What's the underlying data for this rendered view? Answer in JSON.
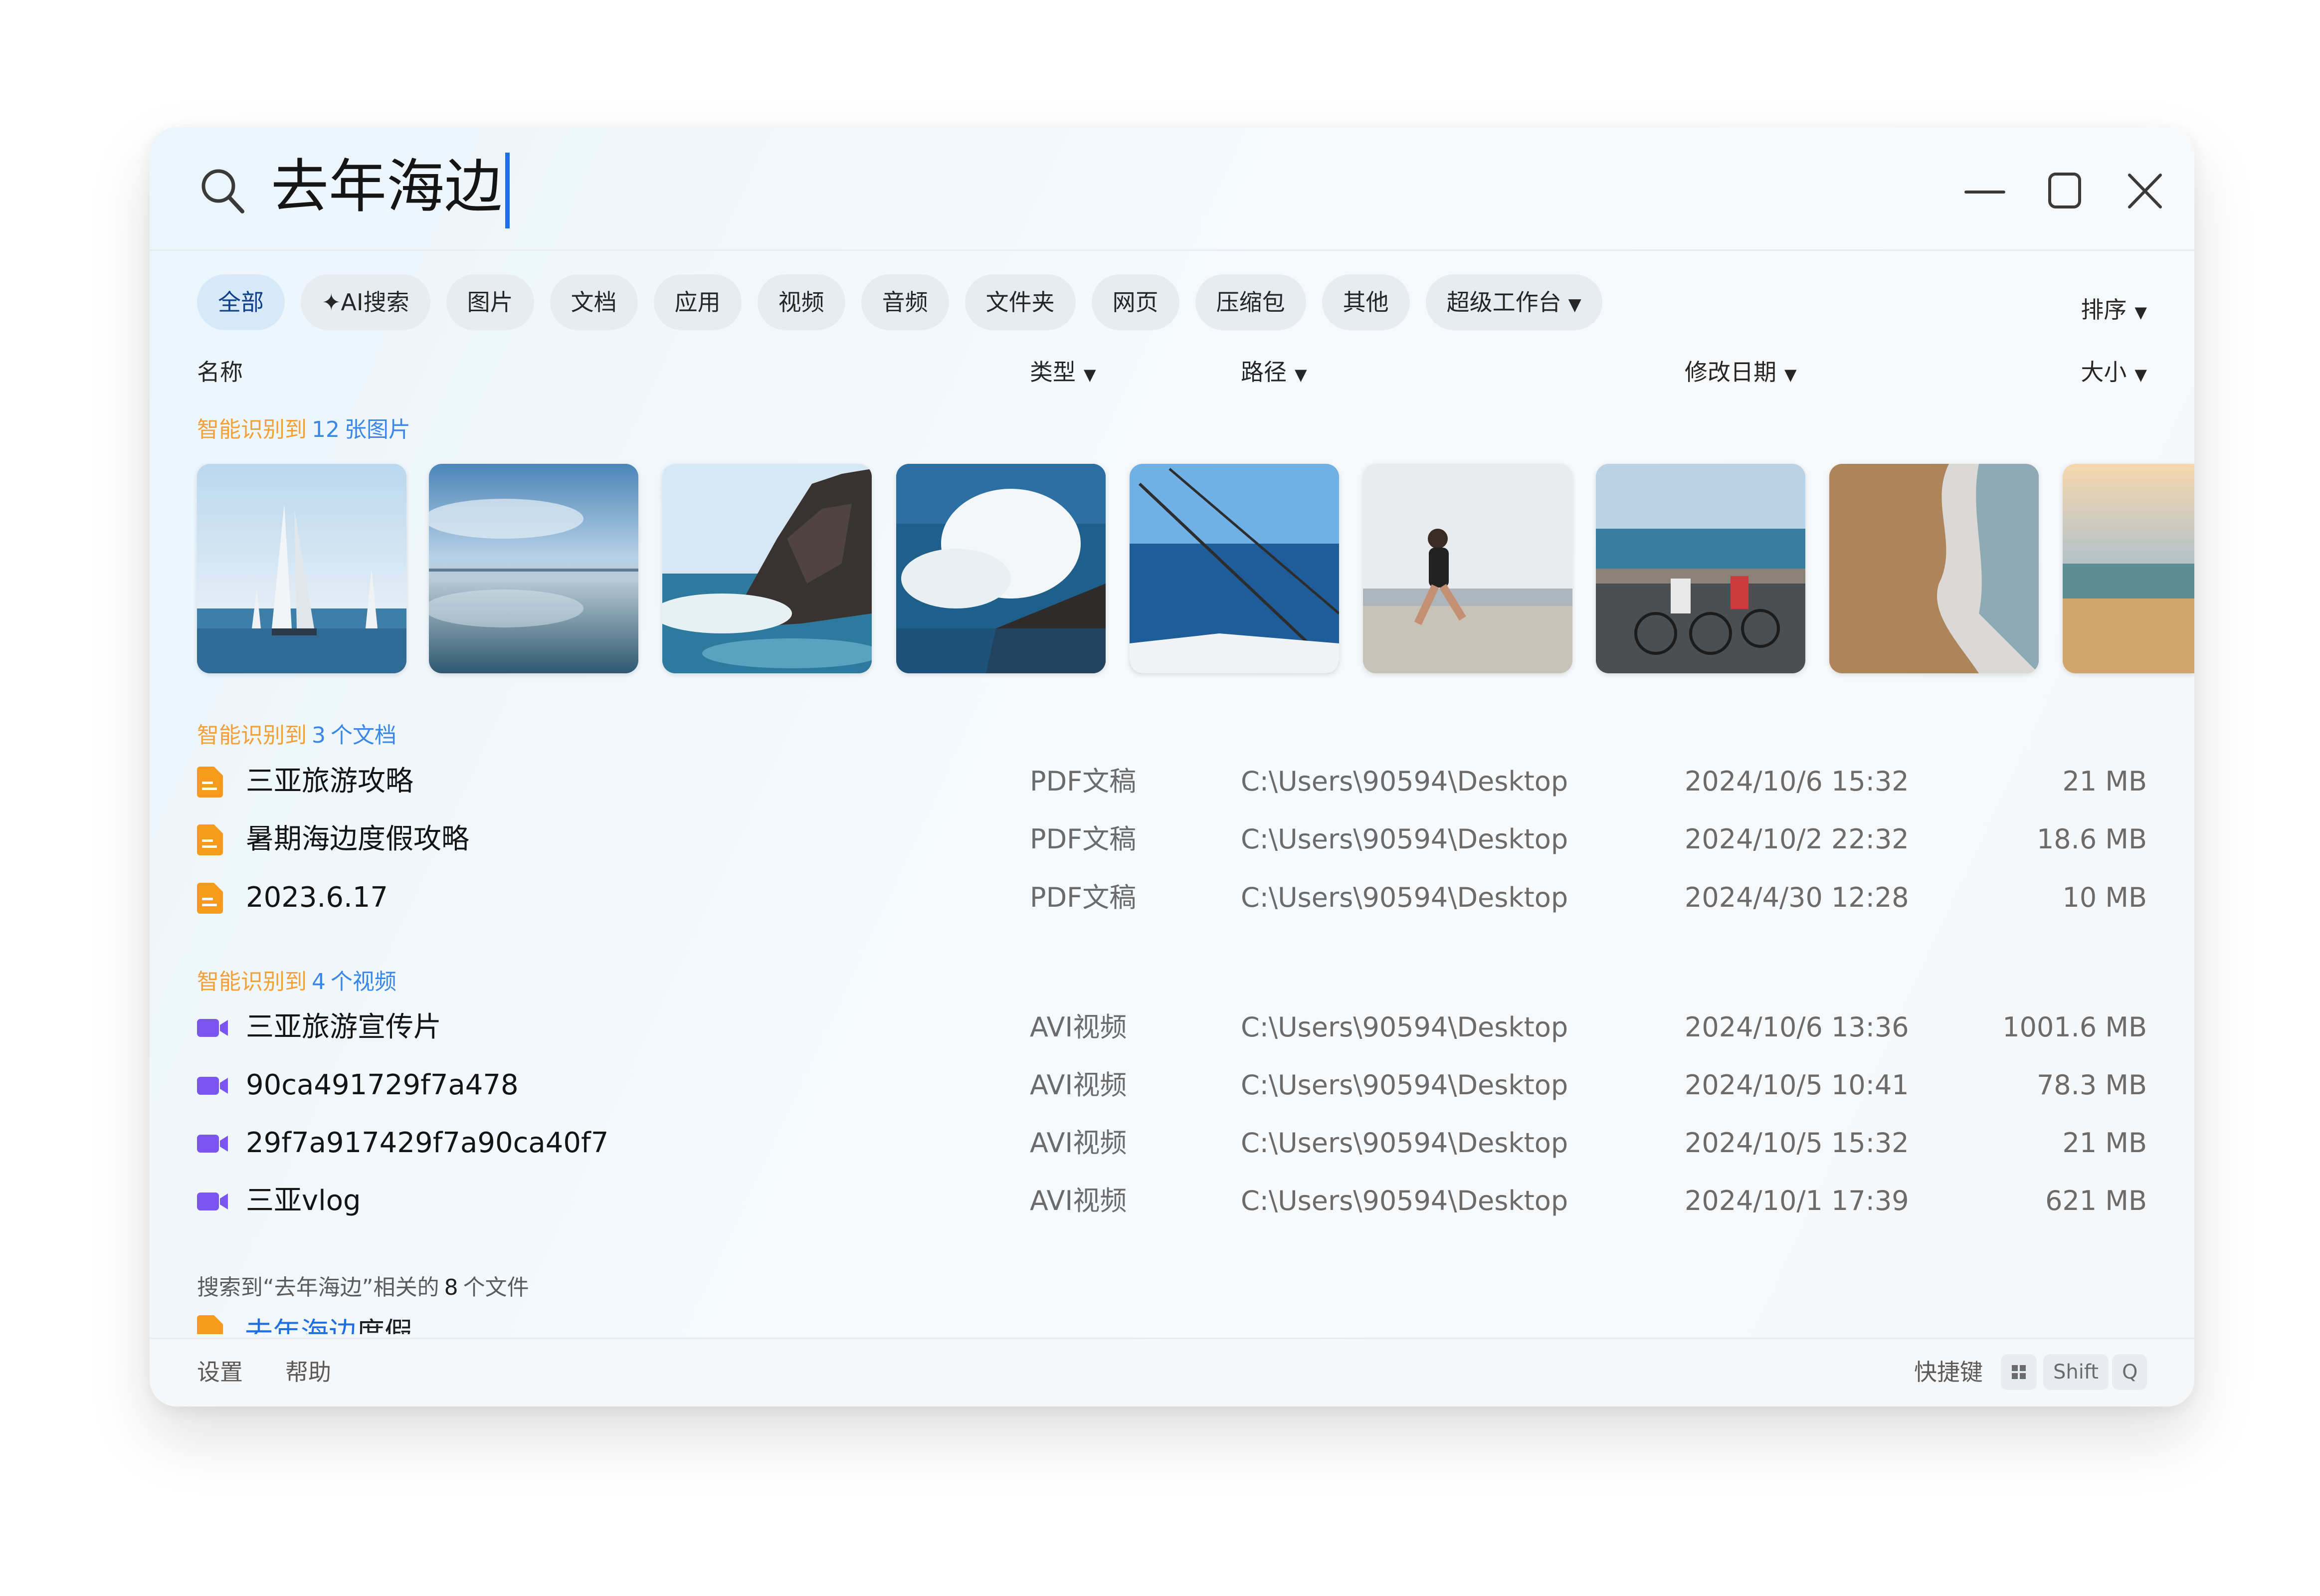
{
  "search": {
    "query": "去年海边"
  },
  "filters": {
    "chips": [
      "全部",
      "✦AI搜索",
      "图片",
      "文档",
      "应用",
      "视频",
      "音频",
      "文件夹",
      "网页",
      "压缩包",
      "其他",
      "超级工作台"
    ],
    "active": "全部",
    "sort_label": "排序"
  },
  "columns": {
    "name": "名称",
    "type": "类型",
    "path": "路径",
    "modified": "修改日期",
    "size": "大小"
  },
  "images_section": {
    "prefix": "智能识别到",
    "count": "12",
    "suffix": "张图片"
  },
  "images": [
    "sailboats",
    "calm-sea",
    "rocky-coast",
    "crashing-waves",
    "fishing-boat",
    "beach-runner",
    "coastal-cyclists",
    "beach-wave-sand",
    "beach-sunset"
  ],
  "docs_section": {
    "prefix": "智能识别到",
    "count": "3",
    "suffix": "个文档"
  },
  "documents": [
    {
      "name": "三亚旅游攻略",
      "type": "PDF文稿",
      "path": "C:\\Users\\90594\\Desktop",
      "date": "2024/10/6  15:32",
      "size": "21 MB"
    },
    {
      "name": "暑期海边度假攻略",
      "type": "PDF文稿",
      "path": "C:\\Users\\90594\\Desktop",
      "date": "2024/10/2  22:32",
      "size": "18.6 MB"
    },
    {
      "name": "2023.6.17",
      "type": "PDF文稿",
      "path": "C:\\Users\\90594\\Desktop",
      "date": "2024/4/30  12:28",
      "size": "10 MB"
    }
  ],
  "videos_section": {
    "prefix": "智能识别到",
    "count": "4",
    "suffix": "个视频"
  },
  "videos": [
    {
      "name": "三亚旅游宣传片",
      "type": "AVI视频",
      "path": "C:\\Users\\90594\\Desktop",
      "date": "2024/10/6  13:36",
      "size": "1001.6 MB"
    },
    {
      "name": "90ca491729f7a478",
      "type": "AVI视频",
      "path": "C:\\Users\\90594\\Desktop",
      "date": "2024/10/5  10:41",
      "size": "78.3 MB"
    },
    {
      "name": "29f7a917429f7a90ca40f7",
      "type": "AVI视频",
      "path": "C:\\Users\\90594\\Desktop",
      "date": "2024/10/5  15:32",
      "size": "21 MB"
    },
    {
      "name": "三亚vlog",
      "type": "AVI视频",
      "path": "C:\\Users\\90594\\Desktop",
      "date": "2024/10/1  17:39",
      "size": "621 MB"
    }
  ],
  "related": {
    "prefix": "搜索到“去年海边”相关的",
    "count": "8",
    "suffix": "个文件"
  },
  "partial_result": {
    "highlight": "去年海边",
    "rest": "度假"
  },
  "footer": {
    "settings": "设置",
    "help": "帮助",
    "shortcut_label": "快捷键",
    "key_shift": "Shift",
    "key_q": "Q"
  },
  "colors": {
    "accent": "#1f6fe0",
    "doc_icon": "#f79a1e",
    "video_icon": "#7a55f0",
    "ai_orange": "#f2a13a",
    "ai_blue": "#3a87e8"
  }
}
